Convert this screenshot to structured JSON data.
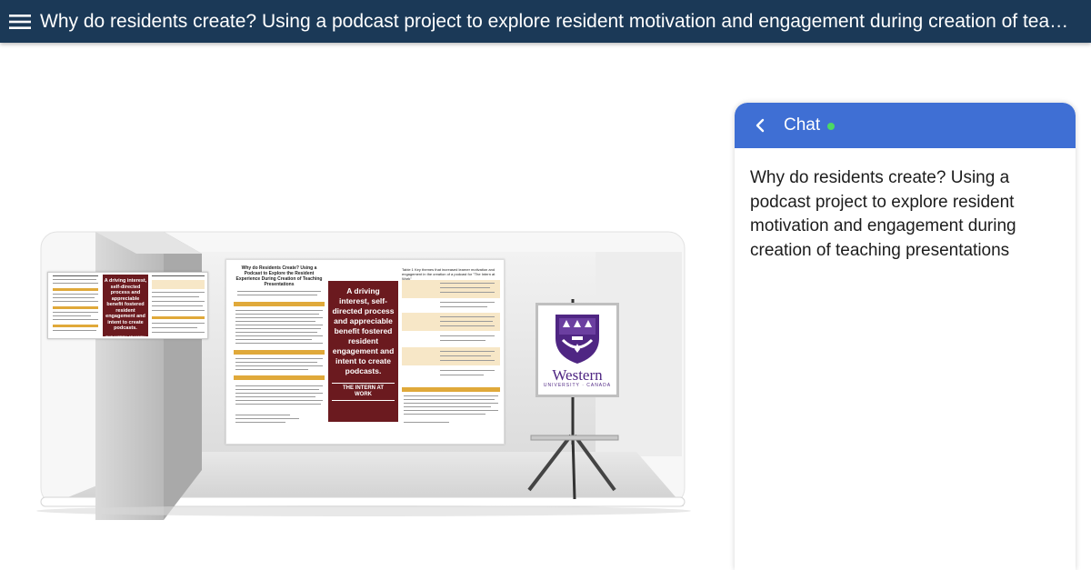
{
  "header": {
    "title": "Why do residents create? Using a podcast project to explore resident motivation and engagement during creation of teaching presentations",
    "menu_icon": "hamburger-menu-icon",
    "background": "#1b3957"
  },
  "booth": {
    "main_poster": {
      "title": "Why do Residents Create? Using a Podcast to Explore the Resident Experience During Creation of Teaching Presentations",
      "callout": "A driving interest, self-directed process and appreciable benefit fostered resident engagement and intent to create podcasts.",
      "badge": "THE INTERN AT WORK",
      "table_title": "Table 1 Key themes that increased learner motivation and engagement in the creation of a podcast for \"The Intern at Work\""
    },
    "side_poster": {
      "callout": "A driving interest, self-directed process and appreciable benefit fostered resident engagement and intent to create podcasts.",
      "badge": "THE INTERN AT WORK"
    },
    "logo": {
      "wordmark": "Western",
      "subtitle": "UNIVERSITY · CANADA",
      "color": "#4f2683"
    }
  },
  "chat": {
    "back_icon": "chevron-left-icon",
    "title": "Chat",
    "status_color": "#4cd964",
    "header_color": "#3f6fd4",
    "message": "Why do residents create? Using a podcast project to explore resident motivation and engagement during creation of teaching presentations"
  }
}
